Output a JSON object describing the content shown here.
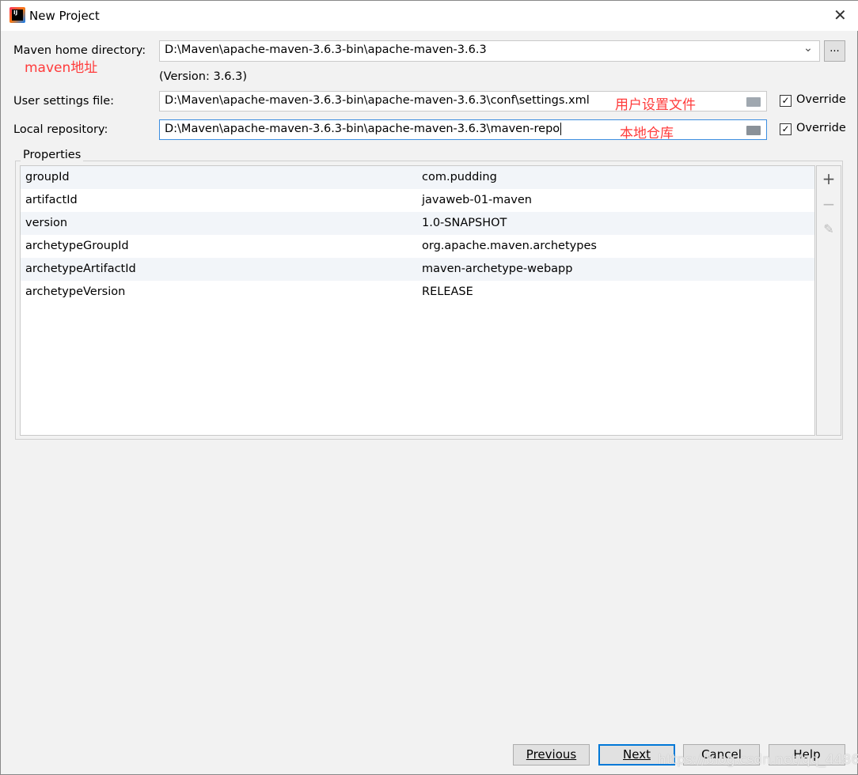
{
  "window": {
    "title": "New Project",
    "close_icon": "close-icon"
  },
  "form": {
    "maven_home": {
      "label": "Maven home directory:",
      "value": "D:\\Maven\\apache-maven-3.6.3-bin\\apache-maven-3.6.3",
      "annotation": "maven地址",
      "browse_label": "...",
      "version": "(Version: 3.6.3)"
    },
    "user_settings": {
      "label": "User settings file:",
      "value": "D:\\Maven\\apache-maven-3.6.3-bin\\apache-maven-3.6.3\\conf\\settings.xml",
      "annotation": "用户设置文件",
      "override_label": "Override",
      "override_checked": true
    },
    "local_repo": {
      "label": "Local repository:",
      "value": "D:\\Maven\\apache-maven-3.6.3-bin\\apache-maven-3.6.3\\maven-repo",
      "annotation": "本地仓库",
      "override_label": "Override",
      "override_checked": true
    }
  },
  "properties": {
    "label": "Properties",
    "rows": [
      {
        "key": "groupId",
        "value": "com.pudding"
      },
      {
        "key": "artifactId",
        "value": "javaweb-01-maven"
      },
      {
        "key": "version",
        "value": "1.0-SNAPSHOT"
      },
      {
        "key": "archetypeGroupId",
        "value": "org.apache.maven.archetypes"
      },
      {
        "key": "archetypeArtifactId",
        "value": "maven-archetype-webapp"
      },
      {
        "key": "archetypeVersion",
        "value": "RELEASE"
      }
    ]
  },
  "buttons": {
    "previous": "Previous",
    "next": "Next",
    "cancel": "Cancel",
    "help": "Help"
  },
  "watermark": "https://blog.csdn.net/qq_44863882",
  "colors": {
    "annotation": "#ff3b3b",
    "focus": "#3d8ee0"
  }
}
